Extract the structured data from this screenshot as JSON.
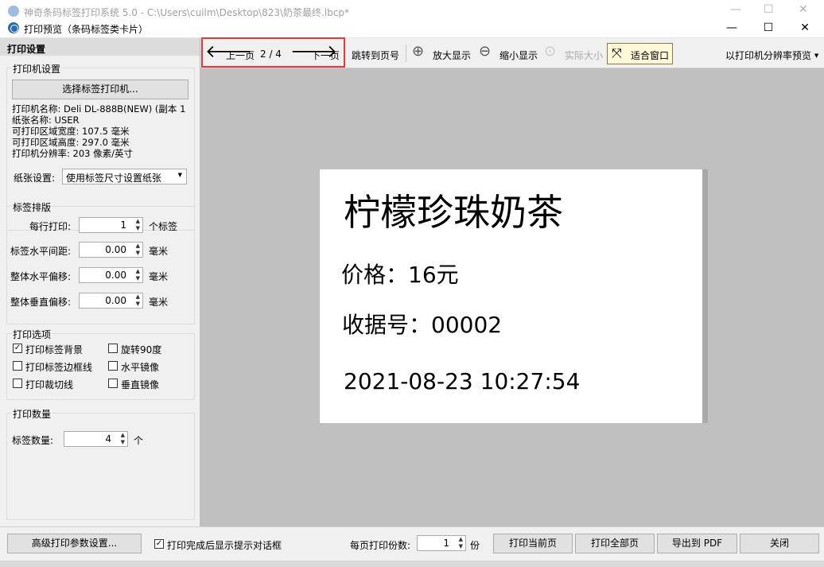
{
  "background_window": {
    "title": "神奇条码标签打印系统 5.0 - C:\\Users\\cuilm\\Desktop\\823\\奶茶最终.lbcp*"
  },
  "dialog": {
    "title": "打印预览（条码标签类卡片）",
    "controls": {
      "minimize": "—",
      "maximize": "☐",
      "close": "✕"
    }
  },
  "left_panel": {
    "header": "打印设置",
    "printer_settings": {
      "title": "打印机设置",
      "select_button": "选择标签打印机...",
      "printer_name": "打印机名称: Deli DL-888B(NEW) (副本 1",
      "paper_name": "纸张名称: USER",
      "printable_width": "可打印区域宽度: 107.5 毫米",
      "printable_height": "可打印区域高度: 297.0 毫米",
      "resolution": "打印机分辨率: 203 像素/英寸",
      "paper_setting_label": "纸张设置:",
      "paper_setting_value": "使用标签尺寸设置纸张"
    },
    "layout": {
      "title": "标签排版",
      "per_row_label": "每行打印:",
      "per_row_value": "1",
      "per_row_unit": "个标签",
      "h_spacing_label": "标签水平间距:",
      "h_spacing_value": "0.00",
      "h_spacing_unit": "毫米",
      "h_offset_label": "整体水平偏移:",
      "h_offset_value": "0.00",
      "h_offset_unit": "毫米",
      "v_offset_label": "整体垂直偏移:",
      "v_offset_value": "0.00",
      "v_offset_unit": "毫米"
    },
    "options": {
      "title": "打印选项",
      "print_background": "打印标签背景",
      "print_border": "打印标签边框线",
      "print_cutline": "打印裁切线",
      "rotate90": "旋转90度",
      "mirror_h": "水平镜像",
      "mirror_v": "垂直镜像"
    },
    "quantity": {
      "title": "打印数量",
      "label": "标签数量:",
      "value": "4",
      "unit": "个"
    }
  },
  "toolbar": {
    "prev": "上一页",
    "page": "2 / 4",
    "next": "下一页",
    "jump": "跳转到页号",
    "zoom_in": "放大显示",
    "zoom_out": "缩小显示",
    "actual_size": "实际大小",
    "fit_window": "适合窗口",
    "resolution_preview": "以打印机分辨率预览"
  },
  "label_preview": {
    "title": "柠檬珍珠奶茶",
    "price": "价格：16元",
    "receipt": "收据号：00002",
    "datetime": "2021-08-23 10:27:54"
  },
  "bottom_bar": {
    "advanced": "高级打印参数设置...",
    "show_dialog": "打印完成后显示提示对话框",
    "copies_label": "每页打印份数:",
    "copies_value": "1",
    "copies_unit": "份",
    "print_current": "打印当前页",
    "print_all": "打印全部页",
    "export_pdf": "导出到 PDF",
    "close": "关闭"
  }
}
